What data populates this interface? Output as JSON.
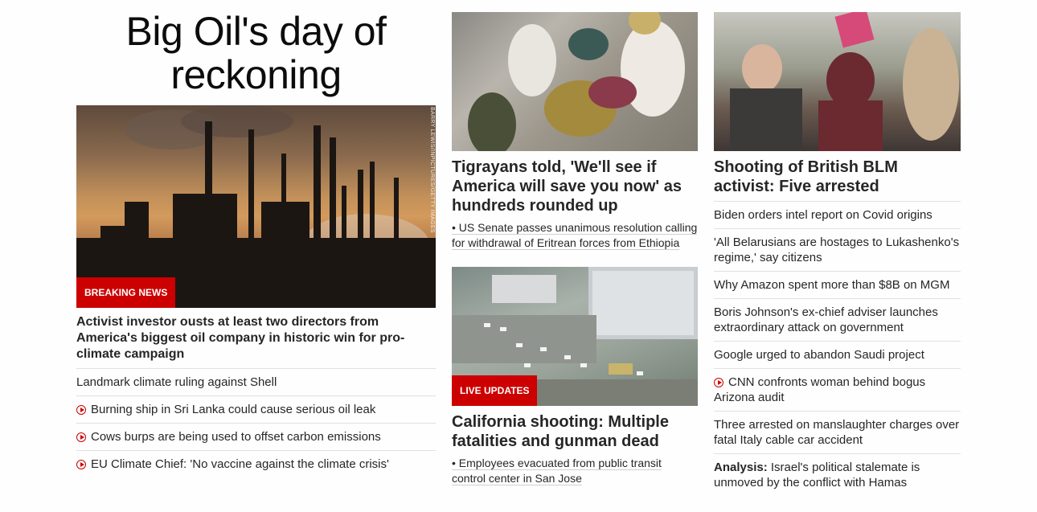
{
  "col1": {
    "headline": "Big Oil's day of reckoning",
    "image_credit": "BARRY LEWIS/INPICTURES/GETTY IMAGES",
    "badge": "BREAKING NEWS",
    "lead_title": "Activist investor ousts at least two directors from America's biggest oil company in historic win for pro-climate campaign",
    "items": [
      {
        "text": "Landmark climate ruling against Shell",
        "video": false
      },
      {
        "text": "Burning ship in Sri Lanka could cause serious oil leak",
        "video": true
      },
      {
        "text": "Cows burps are being used to offset carbon emissions",
        "video": true
      },
      {
        "text": "EU Climate Chief: 'No vaccine against the climate crisis'",
        "video": true
      }
    ]
  },
  "col2": {
    "story1": {
      "title": "Tigrayans told, 'We'll see if America will save you now' as hundreds rounded up",
      "sub": "• US Senate passes unanimous resolution calling for withdrawal of Eritrean forces from Ethiopia"
    },
    "story2": {
      "badge": "LIVE UPDATES",
      "title": "California shooting: Multiple fatalities and gunman dead",
      "sub": "• Employees evacuated from public transit control center in San Jose"
    }
  },
  "col3": {
    "title": "Shooting of British BLM activist: Five arrested",
    "items": [
      {
        "text": "Biden orders intel report on Covid origins",
        "video": false
      },
      {
        "text": "'All Belarusians are hostages to Lukashenko's regime,' say citizens",
        "video": false
      },
      {
        "text": "Why Amazon spent more than $8B on MGM",
        "video": false
      },
      {
        "text": "Boris Johnson's ex-chief adviser launches extraordinary attack on government",
        "video": false
      },
      {
        "text": "Google urged to abandon Saudi project",
        "video": false
      },
      {
        "text": "CNN confronts woman behind bogus Arizona audit",
        "video": true
      },
      {
        "text": "Three arrested on manslaughter charges over fatal Italy cable car accident",
        "video": false
      }
    ],
    "analysis_label": "Analysis:",
    "analysis_text": " Israel's political stalemate is unmoved by the conflict with Hamas"
  },
  "colors": {
    "accent": "#cc0000",
    "text": "#262626",
    "divider": "#e1e1e1"
  }
}
